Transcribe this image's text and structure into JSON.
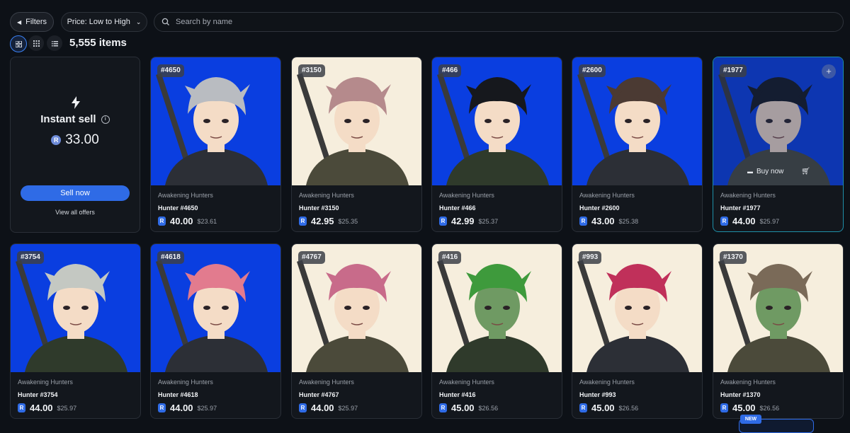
{
  "toolbar": {
    "filters_label": "Filters",
    "sort_label": "Price: Low to High",
    "search_placeholder": "Search by name"
  },
  "view": {
    "item_count": "5,555 items"
  },
  "instant_sell": {
    "title": "Instant sell",
    "price": "33.00",
    "sell_button": "Sell now",
    "offers_link": "View all offers"
  },
  "cards": [
    {
      "badge": "#4650",
      "collection": "Awakening Hunters",
      "name": "Hunter #4650",
      "price": "40.00",
      "usd": "$23.61",
      "bg": "#0a3ee0",
      "hair": "#b9bcc1"
    },
    {
      "badge": "#3150",
      "collection": "Awakening Hunters",
      "name": "Hunter #3150",
      "price": "42.95",
      "usd": "$25.35",
      "bg": "#f6eedd",
      "hair": "#b58a8c"
    },
    {
      "badge": "#466",
      "collection": "Awakening Hunters",
      "name": "Hunter #466",
      "price": "42.99",
      "usd": "$25.37",
      "bg": "#0a3ee0",
      "hair": "#16181d"
    },
    {
      "badge": "#2600",
      "collection": "Awakening Hunters",
      "name": "Hunter #2600",
      "price": "43.00",
      "usd": "$25.38",
      "bg": "#0a3ee0",
      "hair": "#4b3a33"
    },
    {
      "badge": "#1977",
      "collection": "Awakening Hunters",
      "name": "Hunter #1977",
      "price": "44.00",
      "usd": "$25.97",
      "bg": "#0a3ee0",
      "hair": "#15171c",
      "buy_now": "Buy now"
    },
    {
      "badge": "#3754",
      "collection": "Awakening Hunters",
      "name": "Hunter #3754",
      "price": "44.00",
      "usd": "$25.97",
      "bg": "#0a3ee0",
      "hair": "#c4c8c2"
    },
    {
      "badge": "#4618",
      "collection": "Awakening Hunters",
      "name": "Hunter #4618",
      "price": "44.00",
      "usd": "$25.97",
      "bg": "#0a3ee0",
      "hair": "#e27b8e"
    },
    {
      "badge": "#4767",
      "collection": "Awakening Hunters",
      "name": "Hunter #4767",
      "price": "44.00",
      "usd": "$25.97",
      "bg": "#f6eedd",
      "hair": "#c86b8a"
    },
    {
      "badge": "#416",
      "collection": "Awakening Hunters",
      "name": "Hunter #416",
      "price": "45.00",
      "usd": "$26.56",
      "bg": "#f6eedd",
      "hair": "#3e9a3c"
    },
    {
      "badge": "#993",
      "collection": "Awakening Hunters",
      "name": "Hunter #993",
      "price": "45.00",
      "usd": "$26.56",
      "bg": "#f6eedd",
      "hair": "#c0305a"
    },
    {
      "badge": "#1370",
      "collection": "Awakening Hunters",
      "name": "Hunter #1370",
      "price": "45.00",
      "usd": "$26.56",
      "bg": "#f6eedd",
      "hair": "#7a6a58"
    }
  ],
  "new_tag": "NEW",
  "colors": {
    "accent": "#2f6be6",
    "background": "#0d1117",
    "card": "#13171d"
  }
}
